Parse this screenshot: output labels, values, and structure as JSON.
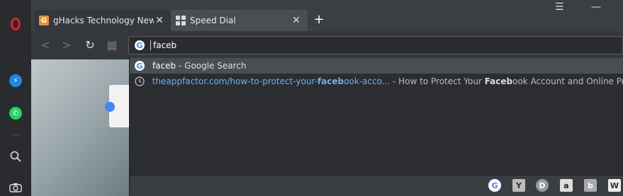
{
  "tabs": [
    {
      "title": "gHacks Technology News",
      "favicon": "G",
      "close": "✕"
    },
    {
      "title": "Speed Dial",
      "close": "✕"
    }
  ],
  "new_tab": "+",
  "window": {
    "menu_icon": "☰",
    "minimize": "—"
  },
  "sidebar": {
    "logo": "O",
    "icons": [
      "messenger-icon",
      "whatsapp-icon",
      "search-icon",
      "camera-icon"
    ]
  },
  "nav": {
    "back": "<",
    "forward": ">",
    "reload": "↻",
    "tabs": "▦"
  },
  "address": {
    "value": "faceb"
  },
  "suggestions": [
    {
      "type": "search",
      "query": "faceb",
      "suffix": " - Google Search"
    },
    {
      "type": "history",
      "url_pre": "theappfactor.com/how-to-protect-your-",
      "url_bold": "faceb",
      "url_post": "ook-acco...",
      "sep": " - ",
      "title_pre": "How to Protect Your ",
      "title_bold": "Faceb",
      "title_post": "ook Account and Online Pr..."
    }
  ],
  "search_engines": [
    "G",
    "Y",
    "D",
    "a",
    "b",
    "W"
  ],
  "colors": {
    "link": "#6fb0f0",
    "opera_red": "#e0202b",
    "messenger": "#1e88e5",
    "whatsapp": "#25d366"
  }
}
